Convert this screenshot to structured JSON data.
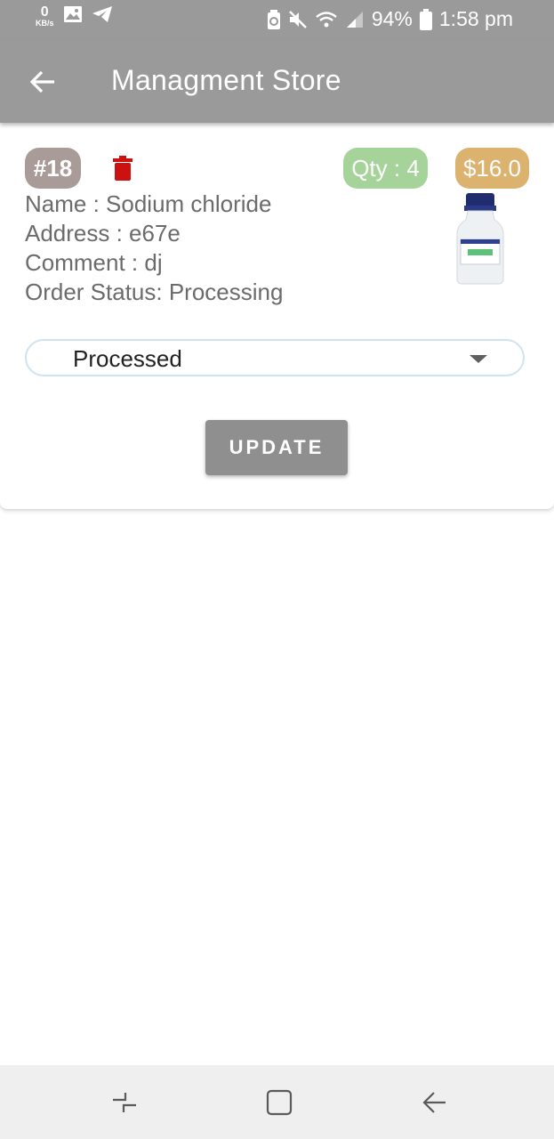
{
  "status_bar": {
    "net_speed_value": "0",
    "net_speed_unit": "KB/s",
    "battery": "94%",
    "time": "1:58 pm"
  },
  "app_bar": {
    "title": "Managment Store"
  },
  "order": {
    "id_badge": "#18",
    "qty_badge": "Qty : 4",
    "price_badge": "$16.0",
    "name_line": "Name : Sodium chloride",
    "address_line": "Address : e67e",
    "comment_line": "Comment : dj",
    "status_line": "Order Status: Processing",
    "status_select": "Processed",
    "update_label": "UPDATE"
  },
  "colors": {
    "app_bar": "#9a9a9a",
    "id_badge": "#a89b98",
    "qty_badge": "#a5d39a",
    "price_badge": "#dcb36e",
    "delete_icon": "#cc1111",
    "update_button": "#8f8f8f"
  },
  "icons": {
    "status_left": [
      "image-icon",
      "telegram-icon"
    ],
    "status_right": [
      "battery-saver-icon",
      "mute-icon",
      "wifi-icon",
      "signal-icon",
      "battery-icon"
    ],
    "nav": [
      "recent-apps-icon",
      "home-icon",
      "back-icon"
    ]
  }
}
